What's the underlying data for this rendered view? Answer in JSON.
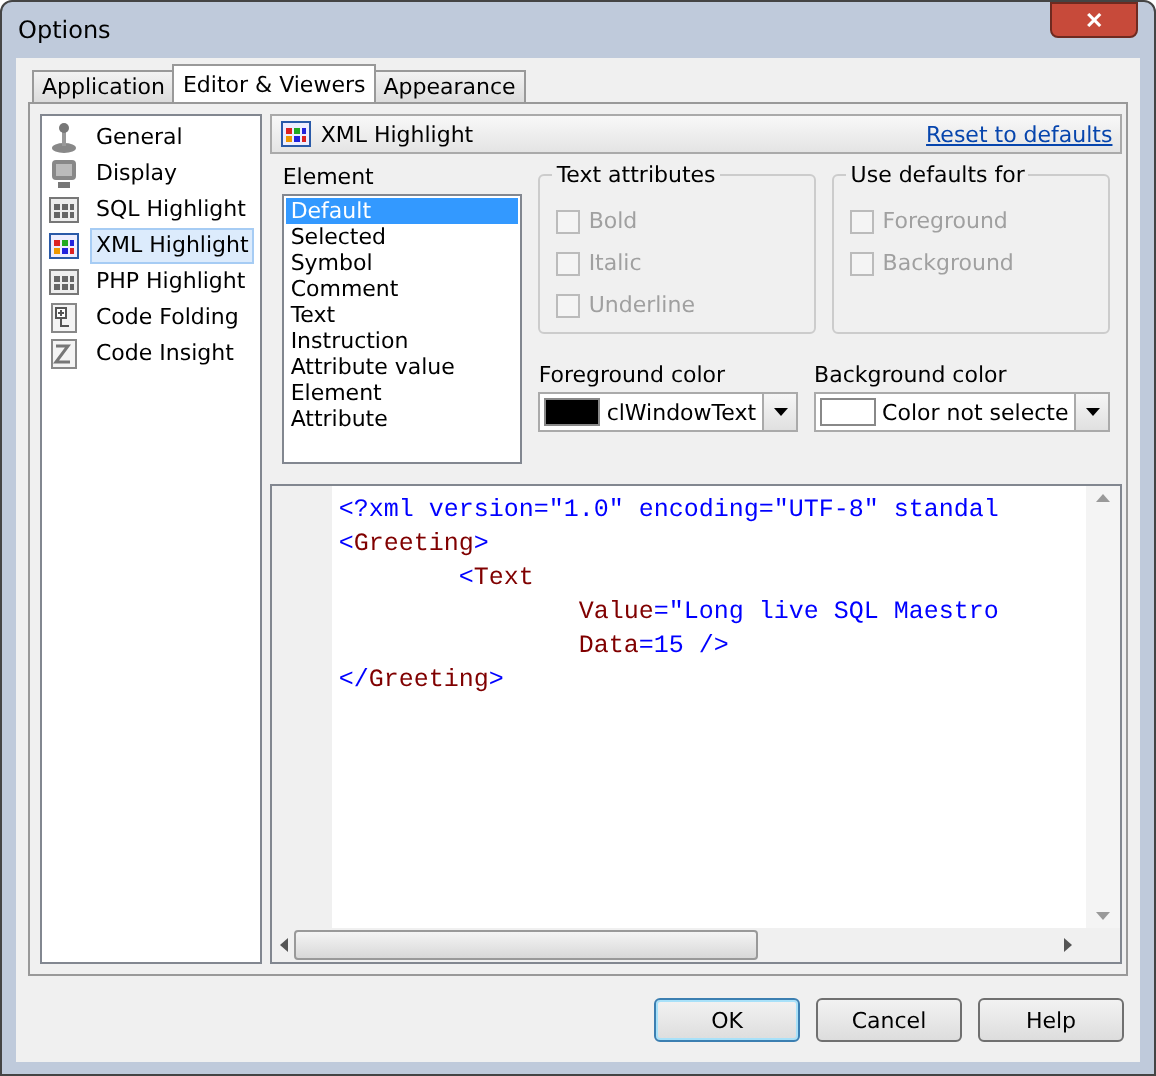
{
  "window": {
    "title": "Options",
    "close_label": "✕"
  },
  "tabs": [
    {
      "label": "Application",
      "selected": false
    },
    {
      "label": "Editor & Viewers",
      "selected": true
    },
    {
      "label": "Appearance",
      "selected": false
    }
  ],
  "sidebar": {
    "items": [
      {
        "label": "General",
        "selected": false
      },
      {
        "label": "Display",
        "selected": false
      },
      {
        "label": "SQL Highlight",
        "selected": false
      },
      {
        "label": "XML Highlight",
        "selected": true
      },
      {
        "label": "PHP Highlight",
        "selected": false
      },
      {
        "label": "Code Folding",
        "selected": false
      },
      {
        "label": "Code Insight",
        "selected": false
      }
    ]
  },
  "panel": {
    "title": "XML Highlight",
    "reset_link": "Reset to defaults",
    "element_label": "Element",
    "elements": [
      {
        "label": "Default",
        "selected": true
      },
      {
        "label": "Selected",
        "selected": false
      },
      {
        "label": "Symbol",
        "selected": false
      },
      {
        "label": "Comment",
        "selected": false
      },
      {
        "label": "Text",
        "selected": false
      },
      {
        "label": "Instruction",
        "selected": false
      },
      {
        "label": "Attribute value",
        "selected": false
      },
      {
        "label": "Element",
        "selected": false
      },
      {
        "label": "Attribute",
        "selected": false
      }
    ],
    "groups": [
      {
        "title": "Text attributes",
        "options": [
          {
            "label": "Bold",
            "checked": false,
            "disabled": true
          },
          {
            "label": "Italic",
            "checked": false,
            "disabled": true
          },
          {
            "label": "Underline",
            "checked": false,
            "disabled": true
          }
        ]
      },
      {
        "title": "Use defaults for",
        "options": [
          {
            "label": "Foreground",
            "checked": false,
            "disabled": true
          },
          {
            "label": "Background",
            "checked": false,
            "disabled": true
          }
        ]
      }
    ],
    "colors": [
      {
        "label": "Foreground color",
        "value": "clWindowText",
        "color": "#000000"
      },
      {
        "label": "Background color",
        "value": "Color not selecte",
        "color": "#ffffff"
      }
    ],
    "code_lines": [
      {
        "segments": [
          {
            "text": "<?xml version=\"1.0\" encoding=\"UTF-8\" standal",
            "kind": "symbol"
          }
        ]
      },
      {
        "segments": [
          {
            "text": "<",
            "kind": "symbol"
          },
          {
            "text": "Greeting",
            "kind": "name"
          },
          {
            "text": ">",
            "kind": "symbol"
          }
        ],
        "children": [
          {
            "segments": [
              {
                "text": "<",
                "kind": "symbol"
              },
              {
                "text": "Text",
                "kind": "name"
              }
            ],
            "children": [
              {
                "segments": [
                  {
                    "text": "Value",
                    "kind": "name"
                  },
                  {
                    "text": "=\"Long live SQL Maestro",
                    "kind": "symbol"
                  }
                ]
              },
              {
                "segments": [
                  {
                    "text": "Data",
                    "kind": "name"
                  },
                  {
                    "text": "=15 />",
                    "kind": "symbol"
                  }
                ]
              }
            ]
          }
        ]
      },
      {
        "segments": [
          {
            "text": "</",
            "kind": "symbol"
          },
          {
            "text": "Greeting",
            "kind": "name"
          },
          {
            "text": ">",
            "kind": "symbol"
          }
        ]
      }
    ]
  },
  "buttons": [
    {
      "label": "OK",
      "default": true
    },
    {
      "label": "Cancel",
      "default": false
    },
    {
      "label": "Help",
      "default": false
    }
  ]
}
